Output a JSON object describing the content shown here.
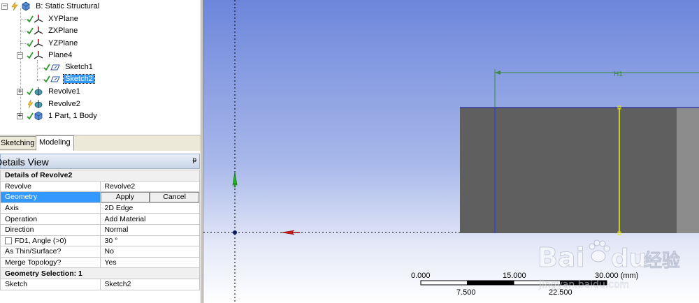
{
  "tree": {
    "root": "B: Static Structural",
    "xy": "XYPlane",
    "zx": "ZXPlane",
    "yz": "YZPlane",
    "plane4": "Plane4",
    "sketch1": "Sketch1",
    "sketch2": "Sketch2",
    "revolve1": "Revolve1",
    "revolve2": "Revolve2",
    "parts": "1 Part, 1 Body"
  },
  "tabs": {
    "sketching": "Sketching",
    "modeling": "Modeling"
  },
  "details": {
    "title": "Details View",
    "pin": "ᵽ",
    "header": "Details of Revolve2",
    "rows": [
      {
        "label": "Revolve",
        "value": "Revolve2"
      },
      {
        "label": "Geometry",
        "apply": "Apply",
        "cancel": "Cancel"
      },
      {
        "label": "Axis",
        "value": "2D Edge"
      },
      {
        "label": "Operation",
        "value": "Add Material"
      },
      {
        "label": "Direction",
        "value": "Normal"
      },
      {
        "label": "FD1,  Angle (>0)",
        "value": "30 °"
      },
      {
        "label": "As Thin/Surface?",
        "value": "No"
      },
      {
        "label": "Merge Topology?",
        "value": "Yes"
      }
    ],
    "group2": "Geometry Selection: 1",
    "sketch_row": {
      "label": "Sketch",
      "value": "Sketch2"
    }
  },
  "viewport": {
    "dimension": "H1",
    "scale": {
      "t0": "0.000",
      "t1": "15.000",
      "t2": "30.000 (mm)",
      "b1": "7.500",
      "b2": "22.500"
    }
  },
  "watermark": {
    "brand": "Bai",
    "brand2": "du",
    "cn": "经验",
    "url": "jingyan.baidu.com"
  },
  "colors": {
    "selection": "#3399ff",
    "viewport_top": "#6d86db",
    "dimension": "#3a8a3a",
    "edge_highlight": "#e6e600"
  }
}
